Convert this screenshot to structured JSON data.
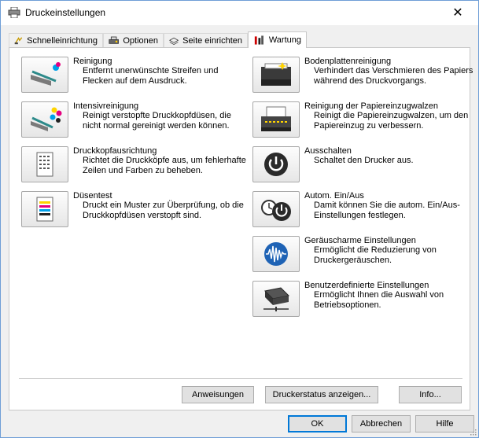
{
  "window": {
    "title": "Druckeinstellungen",
    "close_glyph": "✕"
  },
  "tabs": [
    {
      "label": "Schnelleinrichtung",
      "icon": "quick-setup-icon"
    },
    {
      "label": "Optionen",
      "icon": "options-icon"
    },
    {
      "label": "Seite einrichten",
      "icon": "page-setup-icon"
    },
    {
      "label": "Wartung",
      "icon": "maintenance-icon",
      "active": true
    }
  ],
  "left_items": [
    {
      "title": "Reinigung",
      "desc": "Entfernt unerwünschte Streifen und Flecken auf dem Ausdruck.",
      "icon": "cleaning-icon"
    },
    {
      "title": "Intensivreinigung",
      "desc": "Reinigt verstopfte Druckkopfdüsen, die nicht normal gereinigt werden können.",
      "icon": "deep-cleaning-icon"
    },
    {
      "title": "Druckkopfausrichtung",
      "desc": "Richtet die Druckköpfe aus, um fehlerhafte Zeilen und Farben zu beheben.",
      "icon": "print-head-alignment-icon"
    },
    {
      "title": "Düsentest",
      "desc": "Druckt ein Muster zur Überprüfung, ob die Druckkopfdüsen verstopft sind.",
      "icon": "nozzle-check-icon"
    }
  ],
  "right_items": [
    {
      "title": "Bodenplattenreinigung",
      "desc": "Verhindert das Verschmieren des Papiers während des Druckvorgangs.",
      "icon": "bottom-plate-cleaning-icon"
    },
    {
      "title": "Reinigung der Papiereinzugwalzen",
      "desc": "Reinigt die Papiereinzugwalzen, um den Papiereinzug zu verbessern.",
      "icon": "roller-cleaning-icon"
    },
    {
      "title": "Ausschalten",
      "desc": "Schaltet den Drucker aus.",
      "icon": "power-off-icon"
    },
    {
      "title": "Autom. Ein/Aus",
      "desc": "Damit können Sie die autom. Ein/Aus-Einstellungen festlegen.",
      "icon": "auto-power-icon"
    },
    {
      "title": "Geräuscharme Einstellungen",
      "desc": "Ermöglicht die Reduzierung von Druckergeräuschen.",
      "icon": "quiet-settings-icon"
    },
    {
      "title": "Benutzerdefinierte Einstellungen",
      "desc": "Ermöglicht Ihnen die Auswahl von Betriebsoptionen.",
      "icon": "custom-settings-icon"
    }
  ],
  "panel_buttons": {
    "instructions": "Anweisungen",
    "printer_status": "Druckerstatus anzeigen...",
    "info": "Info..."
  },
  "dialog_buttons": {
    "ok": "OK",
    "cancel": "Abbrechen",
    "help": "Hilfe"
  },
  "colors": {
    "accent": "#0078d7",
    "window_border": "#6e9ed6",
    "panel_bg": "#ffffff"
  }
}
